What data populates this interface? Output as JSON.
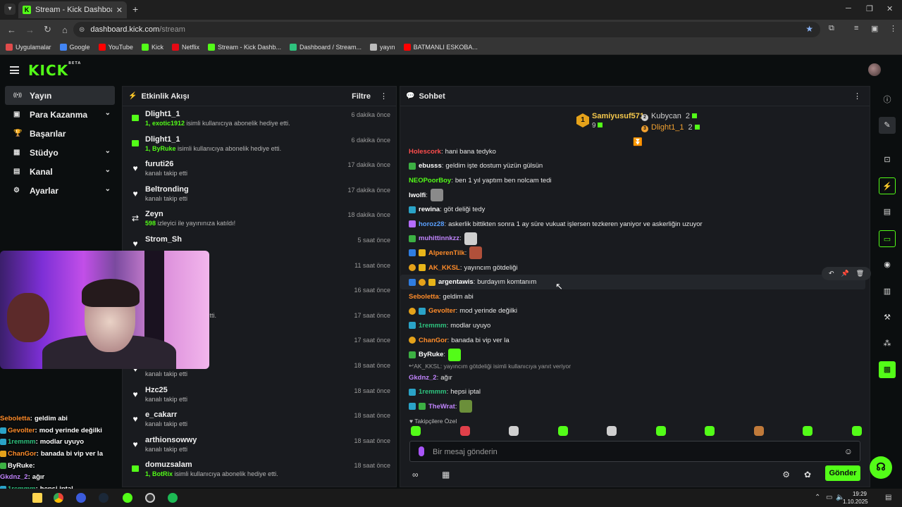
{
  "browser": {
    "tab_title": "Stream - Kick Dashboard",
    "url_host": "dashboard.kick.com",
    "url_path": "/stream",
    "bookmarks": [
      {
        "label": "Uygulamalar",
        "icon": "apps-grid-icon",
        "color": "#e04b4b"
      },
      {
        "label": "Google",
        "icon": "google-icon",
        "color": "#4285f4"
      },
      {
        "label": "YouTube",
        "icon": "youtube-icon",
        "color": "#ff0000"
      },
      {
        "label": "Kick",
        "icon": "kick-icon",
        "color": "#53fc18"
      },
      {
        "label": "Netflix",
        "icon": "netflix-icon",
        "color": "#e50914"
      },
      {
        "label": "Stream - Kick Dashb...",
        "icon": "kick-icon",
        "color": "#53fc18"
      },
      {
        "label": "Dashboard / Stream...",
        "icon": "dashboard-icon",
        "color": "#2ec27e"
      },
      {
        "label": "yayın",
        "icon": "folder-icon",
        "color": "#bbbbbb"
      },
      {
        "label": "BATMANLI ESKOBA...",
        "icon": "youtube-icon",
        "color": "#ff0000"
      }
    ]
  },
  "app": {
    "logo": "KICK",
    "logo_badge": "BETA"
  },
  "sidebar": {
    "items": [
      {
        "label": "Yayın",
        "icon": "broadcast-icon",
        "active": true,
        "expandable": false
      },
      {
        "label": "Para Kazanma",
        "icon": "money-icon",
        "active": false,
        "expandable": true
      },
      {
        "label": "Başarılar",
        "icon": "trophy-icon",
        "active": false,
        "expandable": false
      },
      {
        "label": "Stüdyo",
        "icon": "studio-icon",
        "active": false,
        "expandable": true
      },
      {
        "label": "Kanal",
        "icon": "channel-icon",
        "active": false,
        "expandable": true
      },
      {
        "label": "Ayarlar",
        "icon": "settings-icon",
        "active": false,
        "expandable": true
      }
    ]
  },
  "feed": {
    "title": "Etkinlik Akışı",
    "filter_label": "Filtre",
    "items": [
      {
        "name": "Dlight1_1",
        "highlight": "1, exotic1912",
        "text": " isimli kullanıcıya abonelik hediye etti.",
        "time": "6 dakika önce",
        "icon": "gift-icon"
      },
      {
        "name": "Dlight1_1",
        "highlight": "1, ByRuke",
        "text": " isimli kullanıcıya abonelik hediye etti.",
        "time": "6 dakika önce",
        "icon": "gift-icon"
      },
      {
        "name": "furuti26",
        "highlight": "",
        "text": "kanalı takip etti",
        "time": "17 dakika önce",
        "icon": "heart-icon"
      },
      {
        "name": "Beltronding",
        "highlight": "",
        "text": "kanalı takip etti",
        "time": "17 dakika önce",
        "icon": "heart-icon"
      },
      {
        "name": "Zeyn",
        "highlight": "598",
        "text": " izleyici ile yayınınıza katıldı!",
        "time": "18 dakika önce",
        "icon": "raid-icon"
      },
      {
        "name": "Strom_Sh",
        "highlight": "",
        "text": "",
        "time": "5 saat önce",
        "icon": "heart-icon"
      },
      {
        "name": "",
        "highlight": "",
        "text": "",
        "time": "11 saat önce",
        "icon": ""
      },
      {
        "name": "",
        "highlight": "",
        "text": "",
        "time": "16 saat önce",
        "icon": ""
      },
      {
        "name": "",
        "highlight": "",
        "text": "ıcıya abonelik hediye etti.",
        "time": "17 saat önce",
        "icon": ""
      },
      {
        "name": "",
        "highlight": "",
        "text": "",
        "time": "17 saat önce",
        "icon": ""
      },
      {
        "name": "goawayteur",
        "highlight": "",
        "text": "kanalı takip etti",
        "time": "18 saat önce",
        "icon": "heart-icon"
      },
      {
        "name": "Hzc25",
        "highlight": "",
        "text": "kanalı takip etti",
        "time": "18 saat önce",
        "icon": "heart-icon"
      },
      {
        "name": "e_cakarr",
        "highlight": "",
        "text": "kanalı takip etti",
        "time": "18 saat önce",
        "icon": "heart-icon"
      },
      {
        "name": "arthionsowwy",
        "highlight": "",
        "text": "kanalı takip etti",
        "time": "18 saat önce",
        "icon": "heart-icon"
      },
      {
        "name": "domuzsalam",
        "highlight": "1, BotRix",
        "text": " isimli kullanıcıya abonelik hediye etti.",
        "time": "18 saat önce",
        "icon": "gift-icon"
      }
    ]
  },
  "chat": {
    "title": "Sohbet",
    "leaderboard": {
      "top": {
        "rank": "1",
        "name": "Samiyusuf571",
        "count": "9"
      },
      "others": [
        {
          "rank": "2",
          "name": "Kubycan",
          "count": "2",
          "color": "#cfcfcf"
        },
        {
          "rank": "3",
          "name": "Dlight1_1",
          "count": "2",
          "color": "#f0a030"
        }
      ]
    },
    "messages": [
      {
        "user": "Holescork",
        "color": "#ff4d4d",
        "text": "hani bana tedyko",
        "badges": [],
        "emote": ""
      },
      {
        "user": "ebusss",
        "color": "#ffffff",
        "text": "geldim işte dostum yüzün gülsün",
        "badges": [
          "#3cb043"
        ],
        "emote": ""
      },
      {
        "user": "NEOPoorBoy",
        "color": "#53fc18",
        "text": "ben 1 yıl yaptım ben nolcam tedi",
        "badges": [],
        "emote": ""
      },
      {
        "user": "lwolfi",
        "color": "#ffffff",
        "text": "",
        "badges": [],
        "emote": "#8a8a8a"
      },
      {
        "user": "rewina",
        "color": "#ffffff",
        "text": "göt deliği tedy",
        "badges": [
          "#2aa3c7"
        ],
        "emote": ""
      },
      {
        "user": "horoz28",
        "color": "#5aa0ff",
        "text": "askerlik bittikten sonra 1 ay süre vukuat işlersen tezkeren yaniyor ve askerliğin uzuyor",
        "badges": [
          "#b56cff"
        ],
        "emote": ""
      },
      {
        "user": "muhittinnkzz",
        "color": "#c084fc",
        "text": "",
        "badges": [
          "#3cb043"
        ],
        "emote": "#cfcfcf"
      },
      {
        "user": "AlperenTilk",
        "color": "#ff8c2a",
        "text": "",
        "badges": [
          "#2f7de1",
          "#e8b51a"
        ],
        "emote": "#b0503a"
      },
      {
        "user": "AK_KKSL",
        "color": "#ff8c2a",
        "text": "yayıncım götdeliği",
        "badges": [
          "#e5a21a",
          "#e8b51a"
        ],
        "emote": ""
      },
      {
        "user": "argentawis",
        "color": "#ffffff",
        "text": "burdayım komtanım",
        "badges": [
          "#2f7de1",
          "#e5a21a",
          "#e8b51a"
        ],
        "emote": ""
      },
      {
        "user": "Seboletta",
        "color": "#ff8c2a",
        "text": "geldim abi",
        "badges": [],
        "emote": ""
      },
      {
        "user": "Gevolter",
        "color": "#ff8c2a",
        "text": "mod yerinde değilki",
        "badges": [
          "#e5a21a",
          "#2aa3c7"
        ],
        "emote": ""
      },
      {
        "user": "1remmm",
        "color": "#2ec27e",
        "text": "modlar uyuyo",
        "badges": [
          "#2aa3c7"
        ],
        "emote": ""
      },
      {
        "user": "ChanGor",
        "color": "#ff8c2a",
        "text": "banada bi vip ver la",
        "badges": [
          "#e5a21a"
        ],
        "emote": ""
      },
      {
        "user": "ByRuke",
        "color": "#ffffff",
        "text": "",
        "badges": [
          "#3cb043"
        ],
        "emote": "#53fc18"
      },
      {
        "user": "Gkdnz_2",
        "color": "#c084fc",
        "text": "ağır",
        "badges": [],
        "emote": "",
        "reply": "AK_KKSL: yayıncım götdeliği isimli kullanıcıya yanıt veriyor"
      },
      {
        "user": "1remmm",
        "color": "#2ec27e",
        "text": "hepsi iptal",
        "badges": [
          "#2aa3c7"
        ],
        "emote": ""
      },
      {
        "user": "TheWrat",
        "color": "#c084fc",
        "text": "",
        "badges": [
          "#2aa3c7",
          "#3cb043"
        ],
        "emote": "#6b8f3a"
      }
    ],
    "subscriber_label": "Takipçilere Özel",
    "input_placeholder": "Bir mesaj gönderin",
    "send_label": "Gönder"
  },
  "overlay_chat": [
    {
      "user": "Seboletta",
      "color": "#ff8c2a",
      "text": "geldim abi",
      "badge": ""
    },
    {
      "user": "Gevolter",
      "color": "#ff8c2a",
      "text": "mod yerinde değilki",
      "badge": "#2aa3c7"
    },
    {
      "user": "1remmm",
      "color": "#2ec27e",
      "text": "modlar uyuyo",
      "badge": "#2aa3c7"
    },
    {
      "user": "ChanGor",
      "color": "#ff8c2a",
      "text": "banada bi vip ver la",
      "badge": "#e5a21a"
    },
    {
      "user": "ByRuke",
      "color": "#ffffff",
      "text": "",
      "badge": "#3cb043"
    },
    {
      "user": "Gkdnz_2",
      "color": "#c084fc",
      "text": "ağır",
      "badge": ""
    },
    {
      "user": "1remmm",
      "color": "#2ec27e",
      "text": "hepsi iptal",
      "badge": "#2aa3c7"
    },
    {
      "user": "TheWrat",
      "color": "#c084fc",
      "text": "",
      "badge": "#2aa3c7"
    }
  ],
  "taskbar": {
    "time": "19:29",
    "date": "1.10.2025"
  },
  "colors": {
    "accent": "#53fc18",
    "panel": "#191b1f",
    "background": "#0b0e0f"
  }
}
